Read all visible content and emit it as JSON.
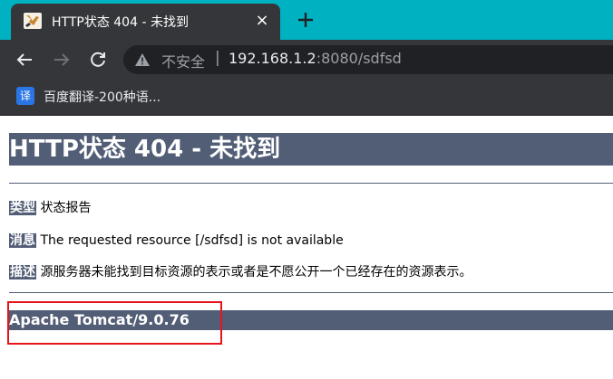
{
  "browser": {
    "tab": {
      "title": "HTTP状态 404 - 未找到",
      "favicon": "tomcat-favicon-icon",
      "close": "×"
    },
    "new_tab": "+",
    "omnibox": {
      "security_label": "不安全",
      "separator": "|",
      "url_host": "192.168.1.2",
      "url_rest": ":8080/sdfsd"
    },
    "bookmarks": [
      {
        "icon_text": "译",
        "label": "百度翻译-200种语..."
      }
    ]
  },
  "page": {
    "title": "HTTP状态 404 - 未找到",
    "rows": [
      {
        "label": "类型",
        "value": "状态报告"
      },
      {
        "label": "消息",
        "value": "The requested resource [/sdfsd] is not available"
      },
      {
        "label": "描述",
        "value": "源服务器未能找到目标资源的表示或者是不愿公开一个已经存在的资源表示。"
      }
    ],
    "footer": "Apache Tomcat/9.0.76"
  },
  "colors": {
    "tab_strip": "#00b2c1",
    "chrome_dark": "#35363a",
    "header_bg": "#525d76",
    "annotation_red": "#e8141c"
  }
}
